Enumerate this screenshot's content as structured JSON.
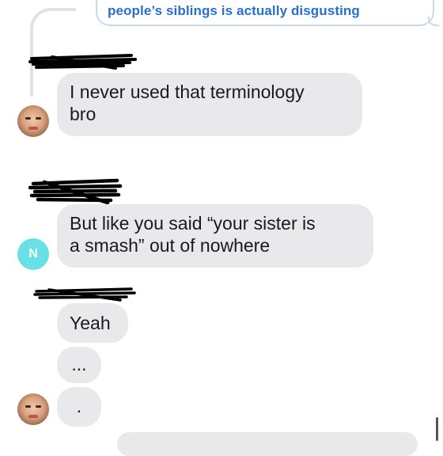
{
  "quoted_message": {
    "text": "people’s siblings is actually disgusting"
  },
  "messages": [
    {
      "text_lines": [
        "I never used that terminology",
        "bro"
      ]
    },
    {
      "text_lines": [
        "But like you said “your sister is",
        "a smash” out of nowhere"
      ]
    },
    {
      "text": "Yeah"
    },
    {
      "text": "..."
    },
    {
      "text": "."
    }
  ],
  "avatars": {
    "letter": "N"
  },
  "colors": {
    "bubble_gray": "#e9e9eb",
    "quote_blue_text": "#2a6fc4",
    "quote_border": "#c9d9ea",
    "avatar_cyan": "#68e0e6"
  },
  "icons": [
    "profile-photo-avatar",
    "letter-avatar",
    "redaction-scribble"
  ]
}
